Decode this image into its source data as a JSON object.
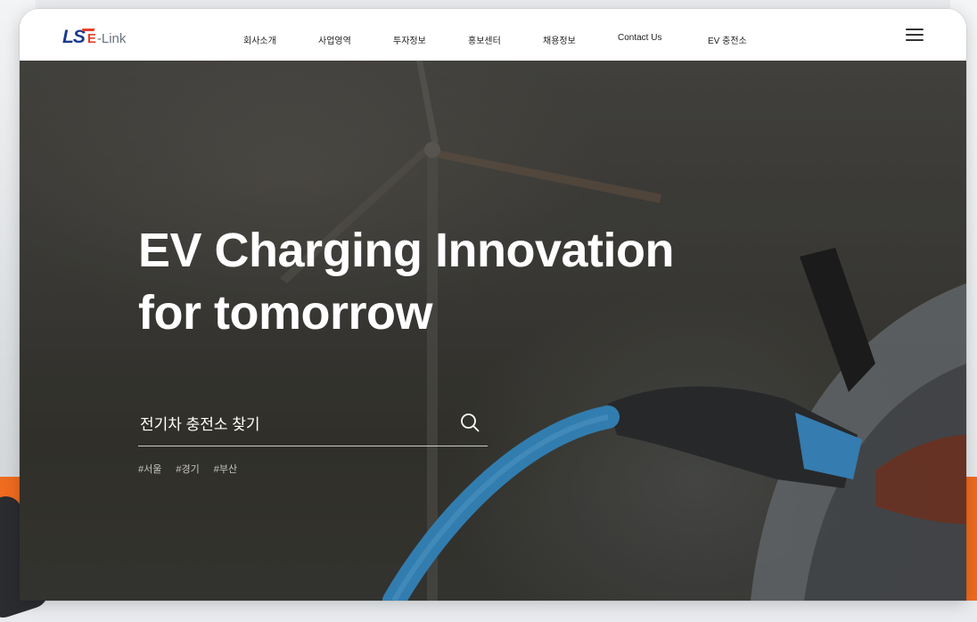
{
  "brand": {
    "logo_main": "LS",
    "logo_e": "E",
    "logo_suffix": "-Link",
    "primary_color": "#1b3b8c",
    "accent_color": "#e6412b"
  },
  "nav": {
    "items": [
      {
        "label": "회사소개"
      },
      {
        "label": "사업영역"
      },
      {
        "label": "투자정보"
      },
      {
        "label": "홍보센터"
      },
      {
        "label": "채용정보"
      },
      {
        "label": "Contact Us"
      },
      {
        "label": "EV 충전소"
      }
    ],
    "menu_icon": "hamburger-menu-icon"
  },
  "hero": {
    "title_line1": "EV Charging Innovation",
    "title_line2": "for tomorrow",
    "search": {
      "placeholder": "전기차 충전소 찾기",
      "icon": "search-icon"
    },
    "tags": [
      "#서울",
      "#경기",
      "#부산"
    ]
  },
  "colors": {
    "background_orange": "#ef6b1f",
    "hero_overlay": "#3f3e3a",
    "cable_blue": "#3a8fc8"
  }
}
